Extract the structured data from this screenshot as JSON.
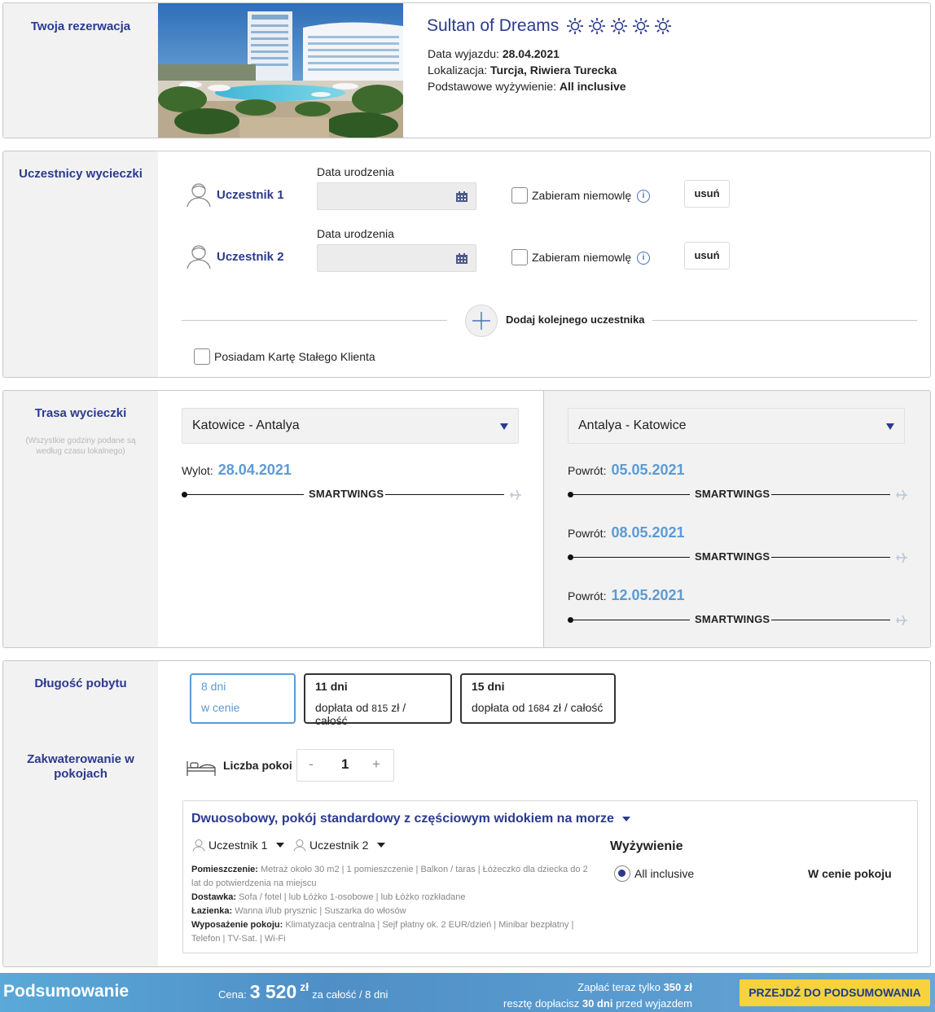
{
  "reservation": {
    "section_title": "Twoja rezerwacja",
    "hotel_name": "Sultan of Dreams",
    "stars": 5,
    "departure_label": "Data wyjazdu:",
    "departure_value": "28.04.2021",
    "location_label": "Lokalizacja:",
    "location_value": "Turcja, Riwiera Turecka",
    "board_label": "Podstawowe wyżywienie:",
    "board_value": "All inclusive"
  },
  "participants": {
    "section_title": "Uczestnicy wycieczki",
    "dob_label": "Data urodzenia",
    "infant_label": "Zabieram niemowlę",
    "remove_label": "usuń",
    "list": [
      {
        "name": "Uczestnik 1"
      },
      {
        "name": "Uczestnik 2"
      }
    ],
    "add_label": "Dodaj kolejnego uczestnika",
    "loyalty_label": "Posiadam Kartę Stałego Klienta"
  },
  "route": {
    "section_title": "Trasa wycieczki",
    "note": "(Wszystkie godziny podane są według czasu lokalnego)",
    "outbound": {
      "select": "Katowice - Antalya",
      "flights": [
        {
          "label": "Wylot:",
          "date": "28.04.2021",
          "airline": "SMARTWINGS"
        }
      ]
    },
    "return": {
      "select": "Antalya - Katowice",
      "flights": [
        {
          "label": "Powrót:",
          "date": "05.05.2021",
          "airline": "SMARTWINGS"
        },
        {
          "label": "Powrót:",
          "date": "08.05.2021",
          "airline": "SMARTWINGS"
        },
        {
          "label": "Powrót:",
          "date": "12.05.2021",
          "airline": "SMARTWINGS"
        }
      ]
    }
  },
  "stay": {
    "section_title": "Długość pobytu",
    "options": [
      {
        "days": "8 dni",
        "sub": "w cenie",
        "amount": "",
        "sub_end": ""
      },
      {
        "days": "11 dni",
        "sub": "dopłata od",
        "amount": "815",
        "sub_end": "zł / całość"
      },
      {
        "days": "15 dni",
        "sub": "dopłata od",
        "amount": "1684",
        "sub_end": "zł / całość"
      }
    ],
    "selected_index": 0
  },
  "rooms": {
    "section_title": "Zakwaterowanie w pokojach",
    "count_label": "Liczba pokoi",
    "count": "1",
    "minus": "-",
    "plus": "+",
    "room_title": "Dwuosobowy, pokój standardowy z częściowym widokiem na morze",
    "assigned": [
      "Uczestnik 1",
      "Uczestnik 2"
    ],
    "features": [
      {
        "label": "Pomieszczenie:",
        "items": "Metraż około 30 m2 | 1 pomieszczenie | Balkon / taras | Łóżeczko dla dziecka do 2 lat do potwierdzenia na miejscu"
      },
      {
        "label": "Dostawka:",
        "items": "Sofa / fotel | lub Łóżko 1-osobowe | lub Łóżko rozkładane"
      },
      {
        "label": "Łazienka:",
        "items": "Wanna i/lub prysznic | Suszarka do włosów"
      },
      {
        "label": "Wyposażenie pokoju:",
        "items": "Klimatyzacja centralna | Sejf płatny ok. 2 EUR/dzień | Minibar bezpłatny | Telefon | TV-Sat. | Wi-Fi"
      }
    ],
    "board_title": "Wyżywienie",
    "board_option": "All inclusive",
    "board_price": "W cenie pokoju"
  },
  "summary": {
    "title": "Podsumowanie",
    "price_label": "Cena:",
    "price_value": "3 520",
    "currency": "zł",
    "price_suffix": "za całość / 8 dni",
    "pay_now_prefix": "Zapłać teraz tylko",
    "pay_now_amount": "350 zł",
    "rest_prefix": "resztę dopłacisz",
    "rest_days": "30 dni",
    "rest_suffix": "przed wyjazdem",
    "cta": "PRZEJDŹ DO PODSUMOWANIA"
  },
  "colors": {
    "brand": "#2b3a8f",
    "accent": "#5b9bd5",
    "cta": "#f6d33c"
  }
}
